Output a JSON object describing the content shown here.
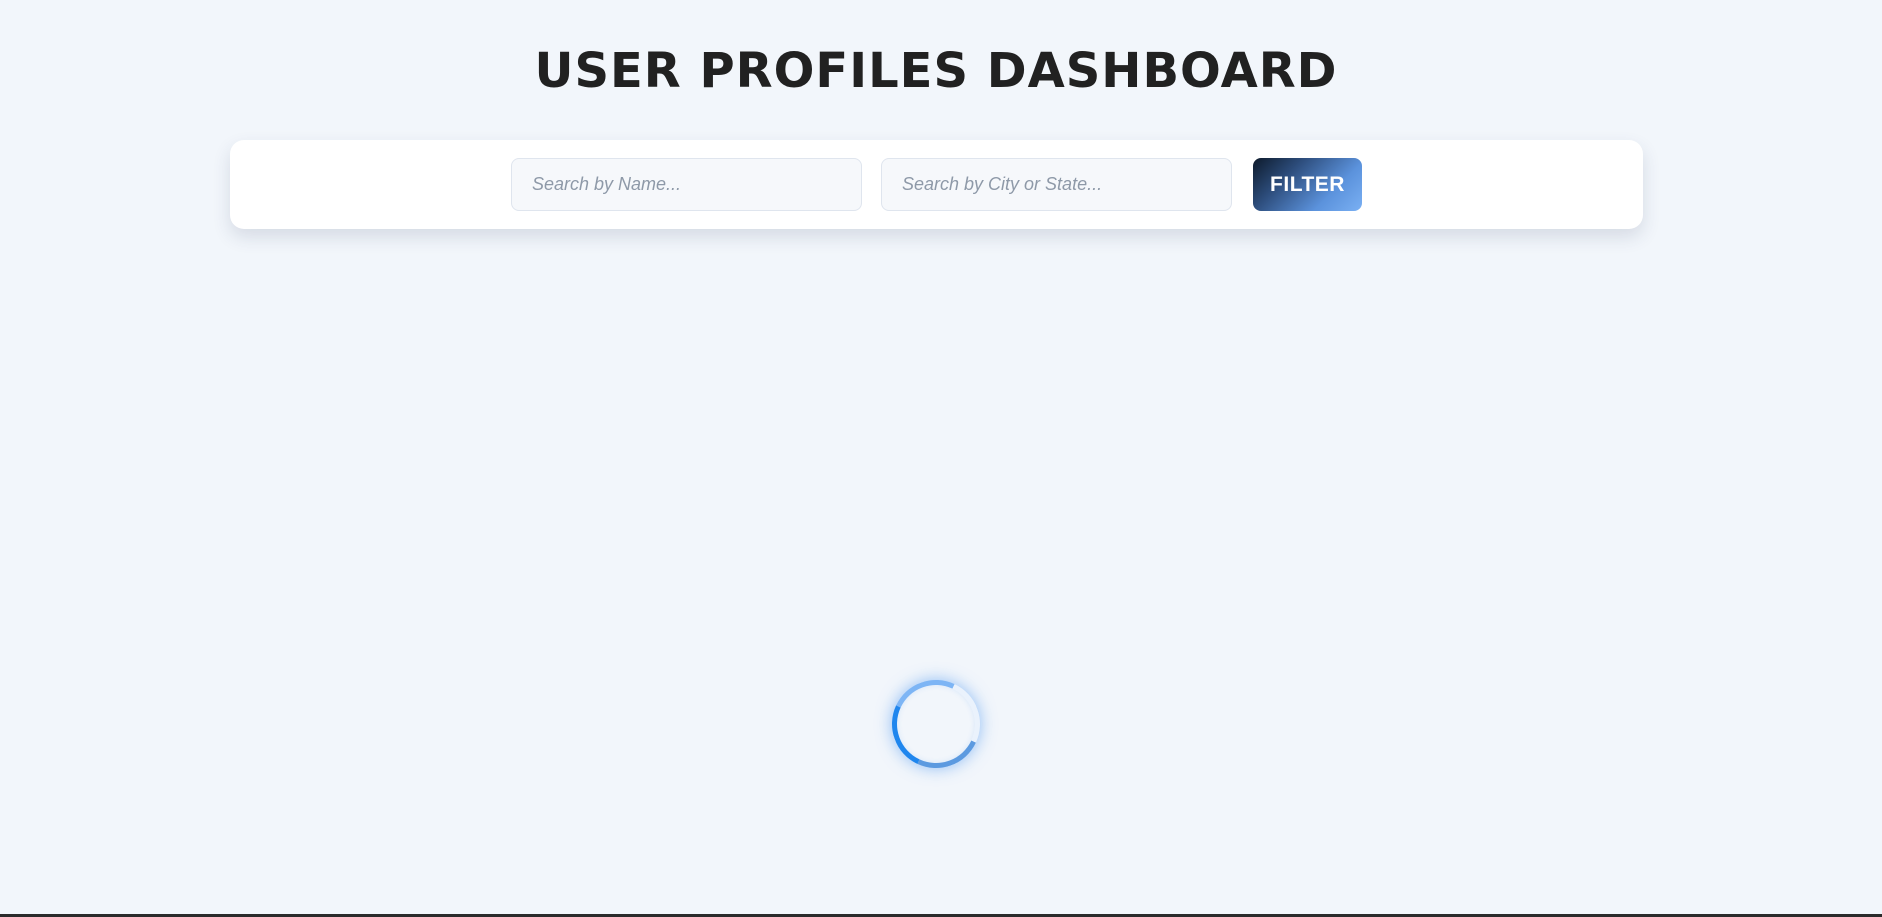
{
  "header": {
    "title": "USER PROFILES DASHBOARD"
  },
  "filters": {
    "name_placeholder": "Search by Name...",
    "location_placeholder": "Search by City or State...",
    "button_label": "FILTER"
  },
  "loading": {
    "icon": "loading-spinner-icon"
  },
  "colors": {
    "background": "#f2f6fb",
    "title": "#212121",
    "accent": "#1f86ee",
    "button_gradient_start": "#0d1a2b",
    "button_gradient_end": "#7ab0f3"
  }
}
